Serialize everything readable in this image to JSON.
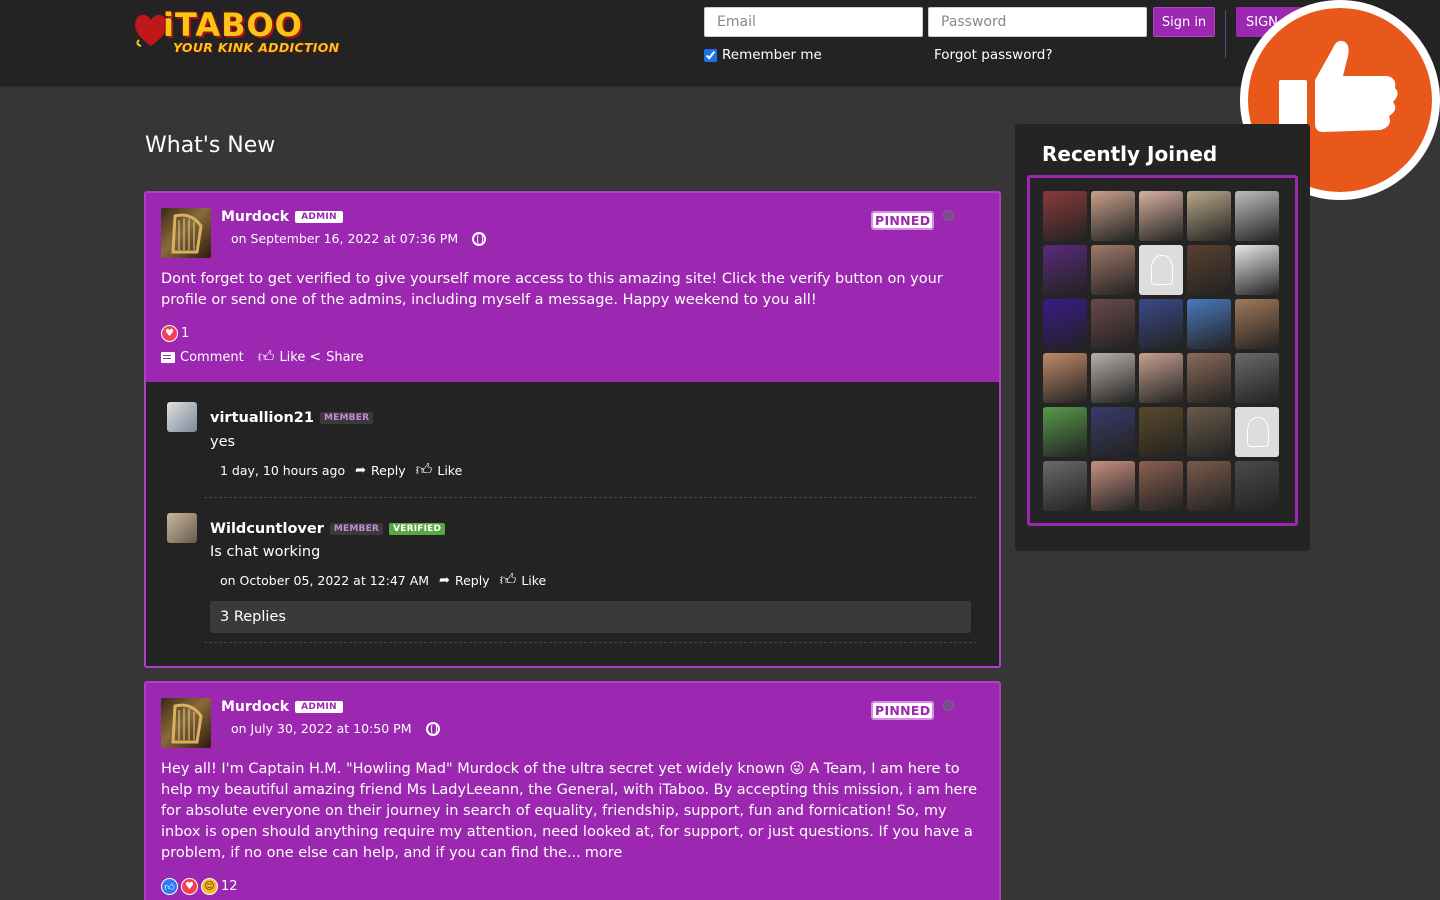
{
  "header": {
    "logo_text": "iTABOO",
    "logo_tagline": "YOUR KINK ADDICTION",
    "email_placeholder": "Email",
    "password_placeholder": "Password",
    "signin_label": "Sign in",
    "signup_label": "SIGN",
    "remember_label": "Remember me",
    "forgot_label": "Forgot password?"
  },
  "main": {
    "title": "What's New"
  },
  "posts": [
    {
      "author": "Murdock",
      "role": "ADMIN",
      "date": "on September 16, 2022 at 07:36 PM",
      "pinned": "PINNED",
      "text": "Dont forget to get verified to give yourself more access to this amazing site! Click the verify button on your profile or send one of the admins, including myself a message. Happy weekend to you all!",
      "reaction_count": "1",
      "actions": {
        "comment": "Comment",
        "like": "Like",
        "share": "Share"
      },
      "comments": [
        {
          "name": "virtuallion21",
          "badge": "MEMBER",
          "text": "yes",
          "time": "1 day, 10 hours ago",
          "reply": "Reply",
          "like": "Like"
        },
        {
          "name": "Wildcuntlover",
          "badge": "MEMBER",
          "verified": "VERIFIED",
          "text": "Is chat working",
          "time": "on October 05, 2022 at 12:47 AM",
          "reply": "Reply",
          "like": "Like",
          "replies": "3 Replies"
        }
      ]
    },
    {
      "author": "Murdock",
      "role": "ADMIN",
      "date": "on July 30, 2022 at 10:50 PM",
      "pinned": "PINNED",
      "text": "Hey all! I'm Captain H.M. \"Howling Mad\" Murdock of the ultra secret yet widely known 😜 A Team, I am here to help my beautiful amazing friend Ms LadyLeeann, the General, with iTaboo. By accepting this mission, i am here for absolute everyone on their journey in search of equality, friendship, support, fun and fornication! So, my inbox is open should anything require my attention, need looked at, for support, or just questions. If you have a problem, if no one else can help, and if you can find the...",
      "more": "more",
      "reaction_count": "12"
    }
  ],
  "sidebar": {
    "title": "Recently Joined",
    "members": [
      "#8b3a3a",
      "#c9a08a",
      "#d8b0a0",
      "#b8a888",
      "#bdbdbd",
      "#5a2a7a",
      "#a07a6a",
      "ph",
      "#5a4030",
      "#e8e8e8",
      "#3a1a8a",
      "#6a4a4a",
      "#3a4a8a",
      "#4a7ac0",
      "#a07a5a",
      "#c08a6a",
      "#b8b0a8",
      "#c8a090",
      "#8a6a5a",
      "#6a6a6a",
      "#5a9a4a",
      "#3a3a6a",
      "#5a4a2a",
      "#6a5a4a",
      "ph",
      "#6a6a6a",
      "#c89080",
      "#8a6050",
      "#7a5a4a",
      "#4a4a4a"
    ]
  },
  "colors": {
    "accent": "#9c27b0",
    "background": "#363636",
    "badge": "#e8581a"
  }
}
